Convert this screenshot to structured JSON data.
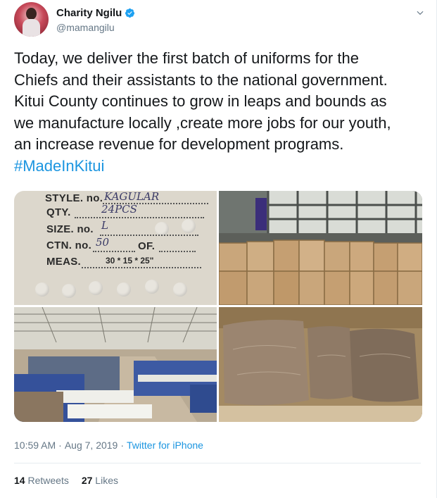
{
  "author": {
    "display_name": "Charity Ngilu",
    "handle": "@mamangilu",
    "verified": true
  },
  "tweet": {
    "lines": [
      "Today, we deliver the first batch of uniforms for the",
      "Chiefs and their assistants to the national government.",
      "Kitui County continues to grow in leaps and bounds as",
      "we manufacture locally ,create more jobs for our youth,",
      "an increase revenue for development programs."
    ],
    "hashtag": "#MadeInKitui"
  },
  "media": {
    "label_photo": {
      "style_label": "STYLE. no.",
      "style_value": "KAGULAR",
      "qty_label": "QTY.",
      "qty_value": "24PCS",
      "size_label": "SIZE. no.",
      "size_value": "L",
      "ctn_label": "CTN. no.",
      "ctn_value": "50",
      "of_label": "OF.",
      "meas_label": "MEAS.",
      "meas_value": "30 * 15 * 25\""
    }
  },
  "meta": {
    "time": "10:59 AM",
    "separator": "·",
    "date": "Aug 7, 2019",
    "source": "Twitter for iPhone"
  },
  "stats": {
    "retweets_count": "14",
    "retweets_label": "Retweets",
    "likes_count": "27",
    "likes_label": "Likes"
  },
  "colors": {
    "link": "#1b95e0",
    "secondary_text": "#657786",
    "primary_text": "#14171a",
    "verified_badge": "#1da1f2",
    "divider": "#e6ecf0"
  },
  "icons": {
    "verified": "verified-badge-icon",
    "caret": "chevron-down-icon"
  }
}
